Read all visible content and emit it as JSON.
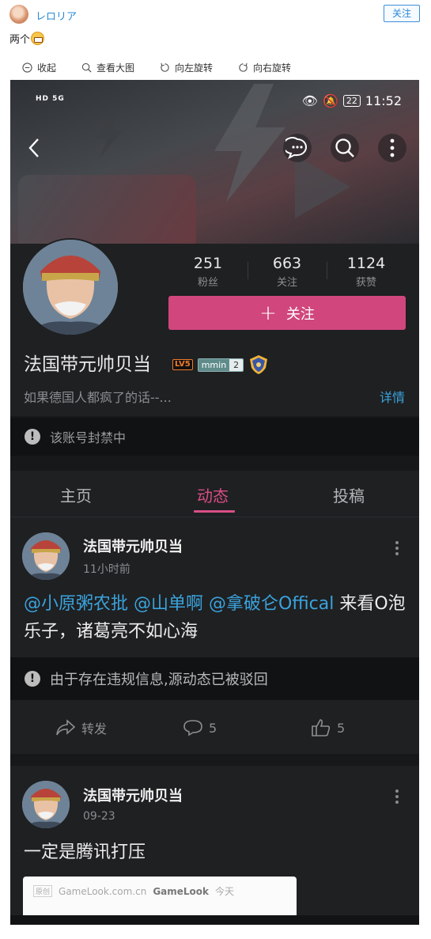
{
  "post": {
    "username": "レロリア",
    "follow_label": "关注",
    "text": "两个",
    "emoji_icon": "grin-emoji-icon",
    "toolbar": [
      {
        "label": "收起",
        "icon": "collapse-icon"
      },
      {
        "label": "查看大图",
        "icon": "zoom-icon"
      },
      {
        "label": "向左旋转",
        "icon": "rotate-left-icon"
      },
      {
        "label": "向右旋转",
        "icon": "rotate-right-icon"
      }
    ]
  },
  "status_bar": {
    "left": "HD 5G",
    "battery": "22",
    "time": "11:52"
  },
  "profile": {
    "stats": [
      {
        "num": "251",
        "label": "粉丝"
      },
      {
        "num": "663",
        "label": "关注"
      },
      {
        "num": "1124",
        "label": "获赞"
      }
    ],
    "follow_label": "关注",
    "name": "法国带元帅贝当",
    "level_badge": "LV5",
    "medal_name": "mmin",
    "medal_level": "2",
    "bio": "如果德国人都疯了的话--...",
    "detail_label": "详情",
    "accent_color": "#d0467d"
  },
  "banned_notice": "该账号封禁中",
  "tabs": [
    {
      "label": "主页",
      "active": false
    },
    {
      "label": "动态",
      "active": true
    },
    {
      "label": "投稿",
      "active": false
    }
  ],
  "feed": [
    {
      "author": "法国带元帅贝当",
      "time": "11小时前",
      "mentions": [
        "@小原粥农批",
        "@山单啊",
        "@拿破仑Offical"
      ],
      "text_after": "来看O泡乐子，诸葛亮不如心海",
      "notice": "由于存在违规信息,源动态已被驳回",
      "repost_label": "转发",
      "comments": "5",
      "likes": "5"
    },
    {
      "author": "法国带元帅贝当",
      "time": "09-23",
      "text": "一定是腾讯打压",
      "quote": {
        "tag": "原创",
        "domain": "GameLook.com.cn",
        "source": "GameLook",
        "time": "今天"
      }
    }
  ]
}
